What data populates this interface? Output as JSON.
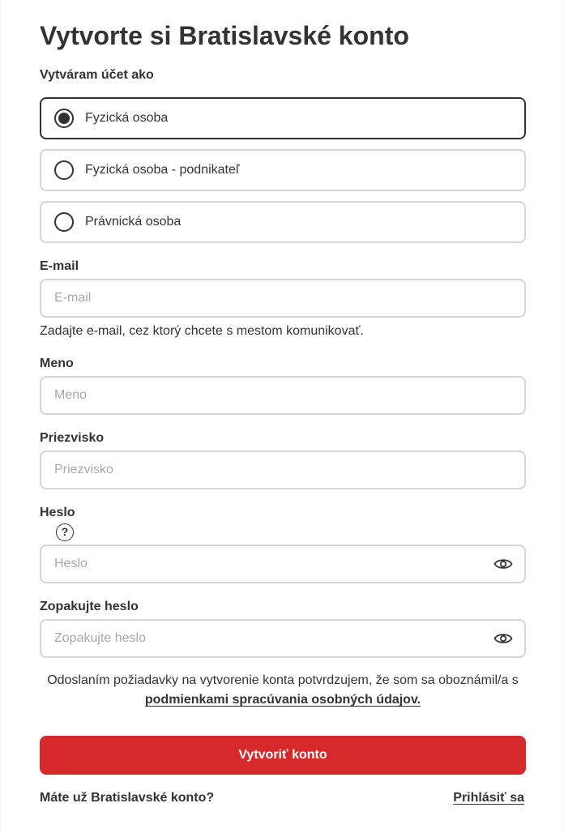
{
  "title": "Vytvorte si Bratislavské konto",
  "account_type": {
    "label": "Vytváram účet ako",
    "options": [
      {
        "label": "Fyzická osoba",
        "selected": true
      },
      {
        "label": "Fyzická osoba - podnikateľ",
        "selected": false
      },
      {
        "label": "Právnická osoba",
        "selected": false
      }
    ]
  },
  "email": {
    "label": "E-mail",
    "placeholder": "E-mail",
    "helper": "Zadajte e-mail, cez ktorý chcete s mestom komunikovať."
  },
  "first_name": {
    "label": "Meno",
    "placeholder": "Meno"
  },
  "last_name": {
    "label": "Priezvisko",
    "placeholder": "Priezvisko"
  },
  "password": {
    "label": "Heslo",
    "placeholder": "Heslo",
    "help_icon": "?"
  },
  "password_repeat": {
    "label": "Zopakujte heslo",
    "placeholder": "Zopakujte heslo"
  },
  "consent": {
    "text": "Odoslaním požiadavky na vytvorenie konta potvrdzujem, že som sa oboznámil/a s",
    "link": "podmienkami spracúvania osobných údajov."
  },
  "submit_label": "Vytvoriť konto",
  "footer": {
    "question": "Máte už Bratislavské konto?",
    "login_link": "Prihlásiť sa"
  },
  "colors": {
    "accent": "#d6292c",
    "text": "#333333",
    "border": "#d6d6d6"
  },
  "icons": {
    "password_toggle": "eye-icon",
    "password_help": "question-circle-icon"
  }
}
